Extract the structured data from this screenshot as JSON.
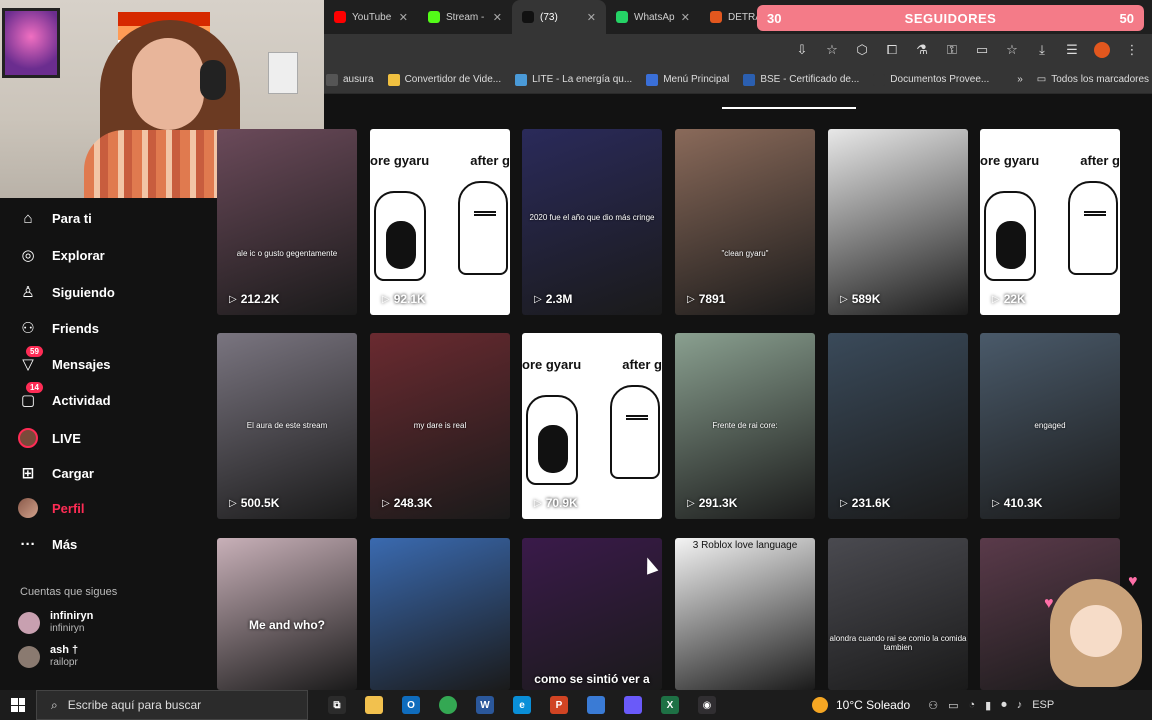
{
  "browser": {
    "tabs": [
      {
        "label": "YouTube",
        "color": "#ff0000",
        "active": false
      },
      {
        "label": "Stream -",
        "color": "#53fc18",
        "active": false
      },
      {
        "label": "(73) ",
        "color": "#111111",
        "active": true
      },
      {
        "label": "WhatsAp",
        "color": "#25d366",
        "active": false
      },
      {
        "label": "DETRA",
        "color": "#e2571e",
        "active": false
      }
    ],
    "bookmarks": [
      {
        "label": "ausura",
        "color": "#555555"
      },
      {
        "label": "Convertidor de Vide...",
        "color": "#f0c040"
      },
      {
        "label": "LITE - La energía qu...",
        "color": "#4a9ad8"
      },
      {
        "label": "Menú Principal",
        "color": "#3a6fd8"
      },
      {
        "label": "BSE - Certificado de...",
        "color": "#2b5fb0"
      },
      {
        "label": "Documentos Provee...",
        "color": "#353535"
      }
    ],
    "all_bookmarks": "Todos los marcadores"
  },
  "subs_bar": {
    "left": "30",
    "label": "SEGUIDORES",
    "right": "50"
  },
  "sidebar": {
    "nav": [
      {
        "label": "Para ti",
        "icon": "home-icon",
        "glyph": "⌂"
      },
      {
        "label": "Explorar",
        "icon": "compass-icon",
        "glyph": "◎"
      },
      {
        "label": "Siguiendo",
        "icon": "user-follow-icon",
        "glyph": "♙"
      },
      {
        "label": "Friends",
        "icon": "friends-icon",
        "glyph": "⚇"
      },
      {
        "label": "Mensajes",
        "icon": "messages-icon",
        "glyph": "▽",
        "badge": "59"
      },
      {
        "label": "Actividad",
        "icon": "activity-icon",
        "glyph": "▢",
        "badge": "14"
      },
      {
        "label": "LIVE",
        "icon": "live-icon",
        "glyph": ""
      },
      {
        "label": "Cargar",
        "icon": "upload-icon",
        "glyph": "⊞"
      },
      {
        "label": "Perfil",
        "icon": "profile-icon",
        "glyph": ""
      },
      {
        "label": "Más",
        "icon": "more-icon",
        "glyph": "···"
      }
    ],
    "following_title": "Cuentas que sigues",
    "accounts": [
      {
        "name": "infiniryn",
        "user": "infiniryn",
        "color": "#c8a0b0"
      },
      {
        "name": "ash †",
        "user": "railopr",
        "color": "#8a7a70"
      }
    ]
  },
  "grid": {
    "tiles": [
      {
        "views": "212.2K",
        "bg": "#6b4a5a",
        "caption": "ale ic o gusto gegentamente",
        "kind": "photo"
      },
      {
        "views": "92.1K",
        "kind": "meme"
      },
      {
        "views": "2.3M",
        "bg": "#2a2a5a",
        "caption": "2020 fue el año que dio más cringe",
        "kind": "photo"
      },
      {
        "views": "7891",
        "bg": "#8a6a5a",
        "caption": "\"clean gyaru\"",
        "kind": "photo"
      },
      {
        "views": "589K",
        "bg": "#e8e8e8",
        "kind": "photo"
      },
      {
        "views": "22K",
        "kind": "meme"
      },
      {
        "views": "500.5K",
        "bg": "#7a7580",
        "caption": "El aura de este stream",
        "kind": "photo"
      },
      {
        "views": "248.3K",
        "bg": "#6a2a30",
        "caption": "my dare is real",
        "kind": "photo"
      },
      {
        "views": "70.9K",
        "kind": "meme"
      },
      {
        "views": "291.3K",
        "bg": "#8aa090",
        "caption": "Frente de rai core:",
        "kind": "photo"
      },
      {
        "views": "231.6K",
        "bg": "#3a4a5a",
        "kind": "photo"
      },
      {
        "views": "410.3K",
        "bg": "#4a5a6a",
        "caption": "engaged",
        "kind": "photo"
      },
      {
        "views": "",
        "bg": "#c8b0b8",
        "caption": "Me and who?",
        "kind": "photo"
      },
      {
        "views": "",
        "bg": "#3a6ab0",
        "kind": "photo"
      },
      {
        "views": "",
        "bg": "#3a1a4a",
        "caption": "como se sintió ver a",
        "kind": "photo"
      },
      {
        "views": "",
        "bg": "#f4f4f4",
        "caption": "3 Roblox love language",
        "kind": "photo"
      },
      {
        "views": "",
        "bg": "#4a4a50",
        "caption": "alondra cuando rai se comio la comida tambien",
        "kind": "photo"
      },
      {
        "views": "",
        "bg": "#5a3a4a",
        "kind": "photo"
      }
    ],
    "meme_left": "ore gyaru",
    "meme_right": "after g"
  },
  "taskbar": {
    "search_placeholder": "Escribe aquí para buscar",
    "weather": "10°C Soleado",
    "lang": "ESP",
    "apps": [
      {
        "name": "task-view-icon",
        "color": "#2b2b2b",
        "glyph": "⧉"
      },
      {
        "name": "file-explorer-icon",
        "color": "#f2c14e",
        "glyph": ""
      },
      {
        "name": "outlook-icon",
        "color": "#0f6cbd",
        "glyph": "O"
      },
      {
        "name": "chrome-icon",
        "color": "#34a853",
        "glyph": ""
      },
      {
        "name": "word-icon",
        "color": "#2b579a",
        "glyph": "W"
      },
      {
        "name": "edge-icon",
        "color": "#0a8fd8",
        "glyph": "e"
      },
      {
        "name": "powerpoint-icon",
        "color": "#d04423",
        "glyph": "P"
      },
      {
        "name": "ruler-icon",
        "color": "#3a7bd5",
        "glyph": ""
      },
      {
        "name": "copilot-icon",
        "color": "#6a5af9",
        "glyph": ""
      },
      {
        "name": "excel-icon",
        "color": "#1e7145",
        "glyph": "X"
      },
      {
        "name": "obs-icon",
        "color": "#302e31",
        "glyph": "◉"
      }
    ]
  }
}
